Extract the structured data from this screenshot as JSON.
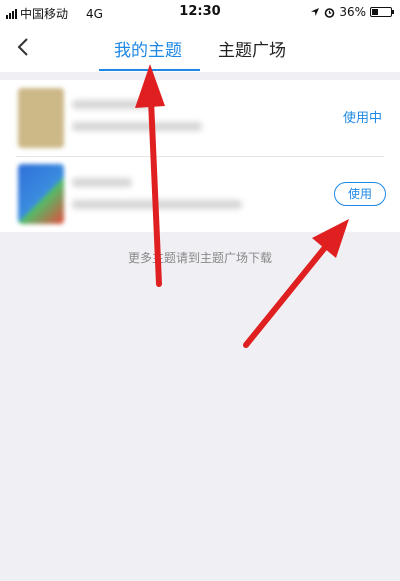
{
  "status_bar": {
    "carrier": "中国移动",
    "network": "4G",
    "time": "12:30",
    "battery": "36%",
    "battery_level": 0.36,
    "icons": [
      "signal-icon",
      "location-icon",
      "alarm-icon",
      "battery-icon"
    ]
  },
  "nav": {
    "back_icon": "chevron-left-icon",
    "tabs": [
      {
        "label": "我的主题",
        "active": true
      },
      {
        "label": "主题广场",
        "active": false
      }
    ]
  },
  "themes": [
    {
      "status": "使用中"
    },
    {
      "action": "使用"
    }
  ],
  "hint": "更多主题请到主题广场下载",
  "colors": {
    "accent": "#1e88e5",
    "annotation_arrow": "#e02020",
    "background": "#efeff4"
  }
}
